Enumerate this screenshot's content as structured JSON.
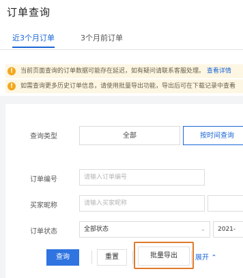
{
  "header": {
    "title": "订单查询"
  },
  "tabs": [
    {
      "label": "近3个月订单"
    },
    {
      "label": "3个月前订单"
    }
  ],
  "notices": [
    {
      "text": "当前页面查询的订单数据可能存在延迟，如有疑问请联系客服处理。",
      "link": "查看详情"
    },
    {
      "text": "如需查询更多历史订单信息，请使用批量导出功能，导出后可在下载记录中查看"
    }
  ],
  "form": {
    "query_type": {
      "label": "查询类型",
      "options": [
        "全部",
        "按时间查询"
      ]
    },
    "order_no": {
      "label": "订单编号",
      "placeholder": "请输入订单编号"
    },
    "buyer": {
      "label": "买家昵称",
      "placeholder": "请输入买家昵称"
    },
    "order_status": {
      "label": "订单状态",
      "value": "全部状态",
      "date_prefix": "2021-"
    }
  },
  "actions": {
    "search": "查询",
    "reset": "重置",
    "export": "批量导出",
    "expand": "展开"
  },
  "colors": {
    "accent": "#1a66d6",
    "primary_button": "#2f74e0",
    "highlight": "#e0792a",
    "warning": "#f2a81d"
  }
}
